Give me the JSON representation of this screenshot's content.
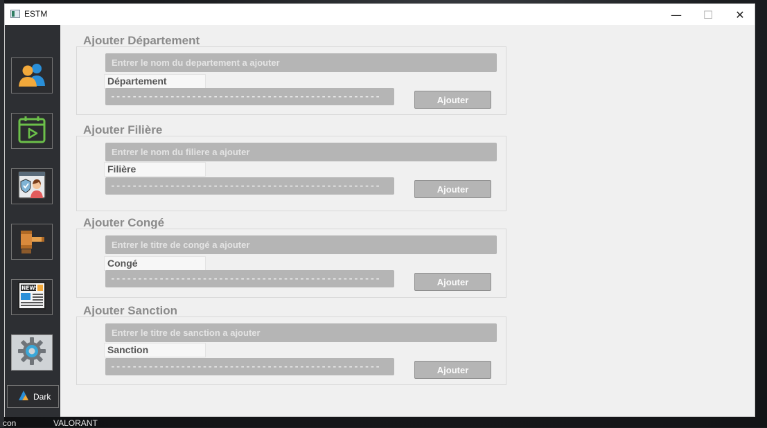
{
  "window": {
    "title": "ESTM",
    "controls": {
      "minimize": "—",
      "maximize": "☐",
      "close": "✕"
    }
  },
  "desktop": {
    "labels": [
      "con",
      "VALORANT"
    ]
  },
  "sidebar": {
    "items": [
      {
        "icon": "users-icon"
      },
      {
        "icon": "calendar-play-icon"
      },
      {
        "icon": "security-staff-icon"
      },
      {
        "icon": "gavel-icon"
      },
      {
        "icon": "news-icon"
      },
      {
        "icon": "gear-icon"
      }
    ],
    "theme_label": "Dark"
  },
  "sections": [
    {
      "title": "Ajouter Département",
      "placeholder": "Entrer le nom du departement a ajouter",
      "tag": "Département",
      "value": "--------------------------------------------------",
      "button": "Ajouter"
    },
    {
      "title": "Ajouter Filière",
      "placeholder": "Entrer le nom du filiere a ajouter",
      "tag": "Filière",
      "value": "--------------------------------------------------",
      "button": "Ajouter"
    },
    {
      "title": "Ajouter Congé",
      "placeholder": "Entrer le titre de congé a ajouter",
      "tag": "Congé",
      "value": "--------------------------------------------------",
      "button": "Ajouter"
    },
    {
      "title": "Ajouter Sanction",
      "placeholder": "Entrer le titre de sanction a ajouter",
      "tag": "Sanction",
      "value": "--------------------------------------------------",
      "button": "Ajouter"
    }
  ]
}
